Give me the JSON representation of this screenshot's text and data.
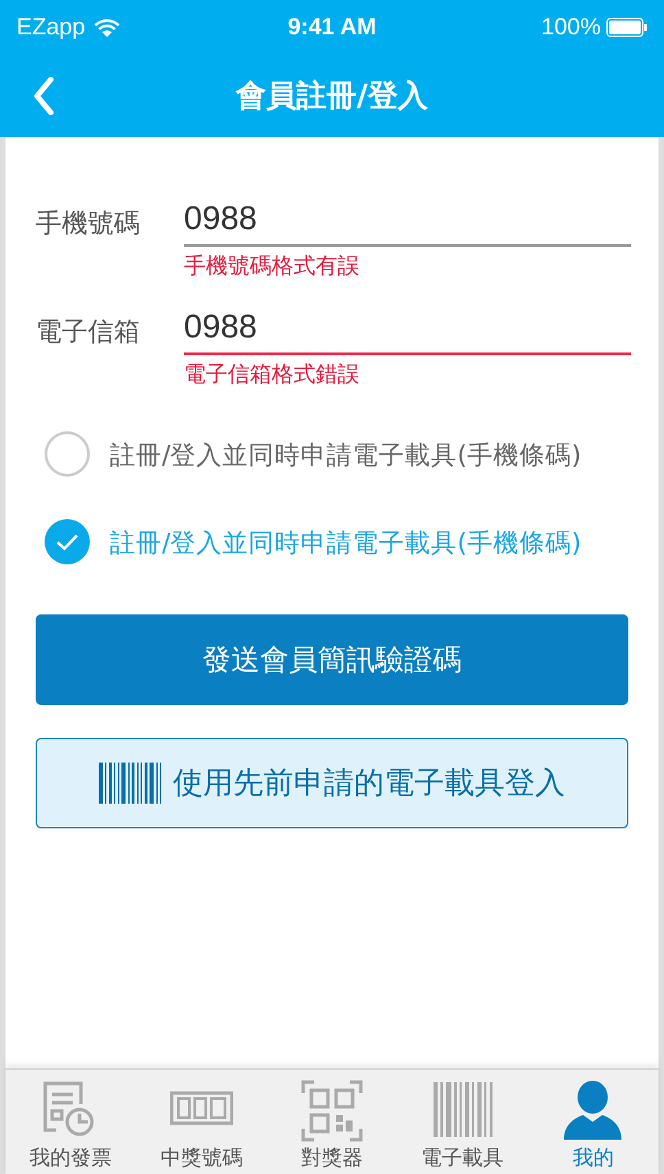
{
  "status_bar": {
    "carrier": "EZapp",
    "time": "9:41 AM",
    "battery": "100%"
  },
  "nav_bar": {
    "title": "會員註冊/登入"
  },
  "fields": [
    {
      "label": "手機號碼",
      "value": "0988",
      "invalid": false,
      "error": "手機號碼格式有誤"
    },
    {
      "label": "電子信箱",
      "value": "0988",
      "invalid": true,
      "error": "電子信箱格式錯誤"
    }
  ],
  "options": [
    {
      "label": "註冊/登入並同時申請電子載具(手機條碼)",
      "checked": false
    },
    {
      "label": "註冊/登入並同時申請電子載具(手機條碼)",
      "checked": true
    }
  ],
  "buttons": [
    {
      "kind": "primary",
      "label": "發送會員簡訊驗證碼"
    },
    {
      "kind": "barcode",
      "label": "使用先前申請的電子載具登入"
    }
  ],
  "tab_bar": [
    {
      "kind": "invoice",
      "label": "我的發票",
      "selected": false
    },
    {
      "kind": "lottery",
      "label": "中獎號碼",
      "selected": false
    },
    {
      "kind": "scanner",
      "label": "對獎器",
      "selected": false
    },
    {
      "kind": "barcode",
      "label": "電子載具",
      "selected": false
    },
    {
      "kind": "person",
      "label": "我的",
      "selected": true
    }
  ]
}
